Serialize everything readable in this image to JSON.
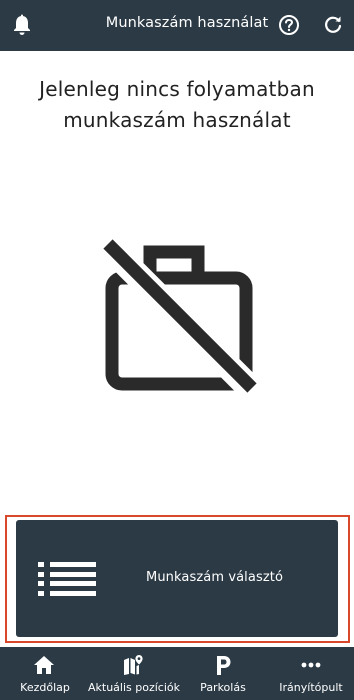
{
  "header": {
    "title": "Munkaszám használat",
    "icons": [
      "bell-icon",
      "help-icon",
      "refresh-icon"
    ]
  },
  "empty_state": {
    "line1": "Jelenleg nincs folyamatban",
    "line2": "munkaszám használat",
    "icon": "work-off-icon"
  },
  "selector": {
    "label": "Munkaszám választó",
    "icon": "list-icon"
  },
  "bottom_nav": {
    "items": [
      {
        "label": "Kezdőlap",
        "icon": "home-icon"
      },
      {
        "label": "Aktuális pozíciók",
        "icon": "map-pin-icon"
      },
      {
        "label": "Parkolás",
        "icon": "parking-icon"
      },
      {
        "label": "Irányítópult",
        "icon": "more-icon"
      }
    ]
  },
  "colors": {
    "bar_background": "#2b3a45",
    "highlight_border": "#d9482b",
    "text_dark": "#222222"
  }
}
